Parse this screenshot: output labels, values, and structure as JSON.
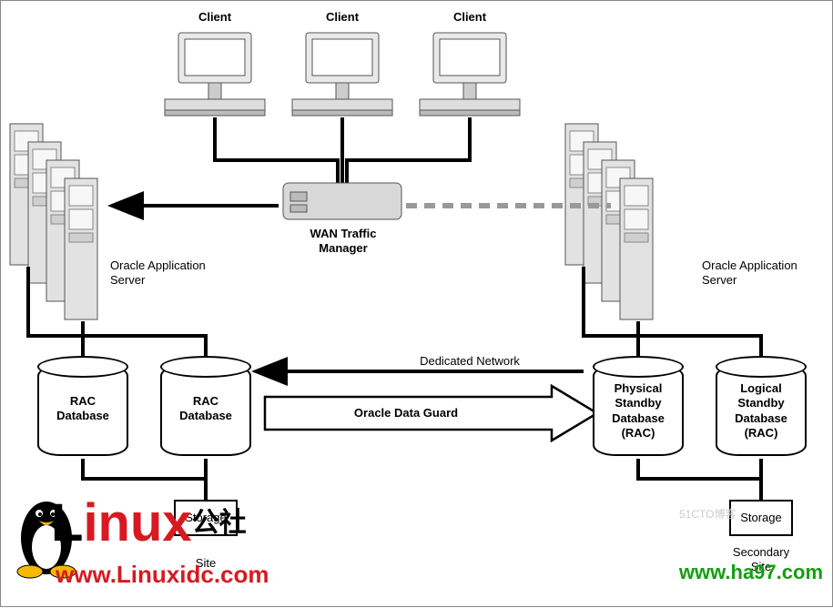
{
  "clients": {
    "label": "Client"
  },
  "wan": {
    "line1": "WAN Traffic",
    "line2": "Manager"
  },
  "oas_left": {
    "line1": "Oracle Application",
    "line2": "Server"
  },
  "oas_right": {
    "line1": "Oracle Application",
    "line2": "Server"
  },
  "db_left1": {
    "line1": "RAC",
    "line2": "Database"
  },
  "db_left2": {
    "line1": "RAC",
    "line2": "Database"
  },
  "db_right1": {
    "line1": "Physical",
    "line2": "Standby",
    "line3": "Database",
    "line4": "(RAC)"
  },
  "db_right2": {
    "line1": "Logical",
    "line2": "Standby",
    "line3": "Database",
    "line4": "(RAC)"
  },
  "dedicated": "Dedicated Network",
  "dataguard": "Oracle Data Guard",
  "storage": "Storage",
  "site_left": "Site",
  "site_right": {
    "line1": "Secondary",
    "line2": "Site"
  },
  "wm1": {
    "text": "Linux",
    "cn": "公社"
  },
  "wm1_sub": "www.Linuxidc.com",
  "wm2": "www.ha97.com",
  "faint": "51CTO博客"
}
